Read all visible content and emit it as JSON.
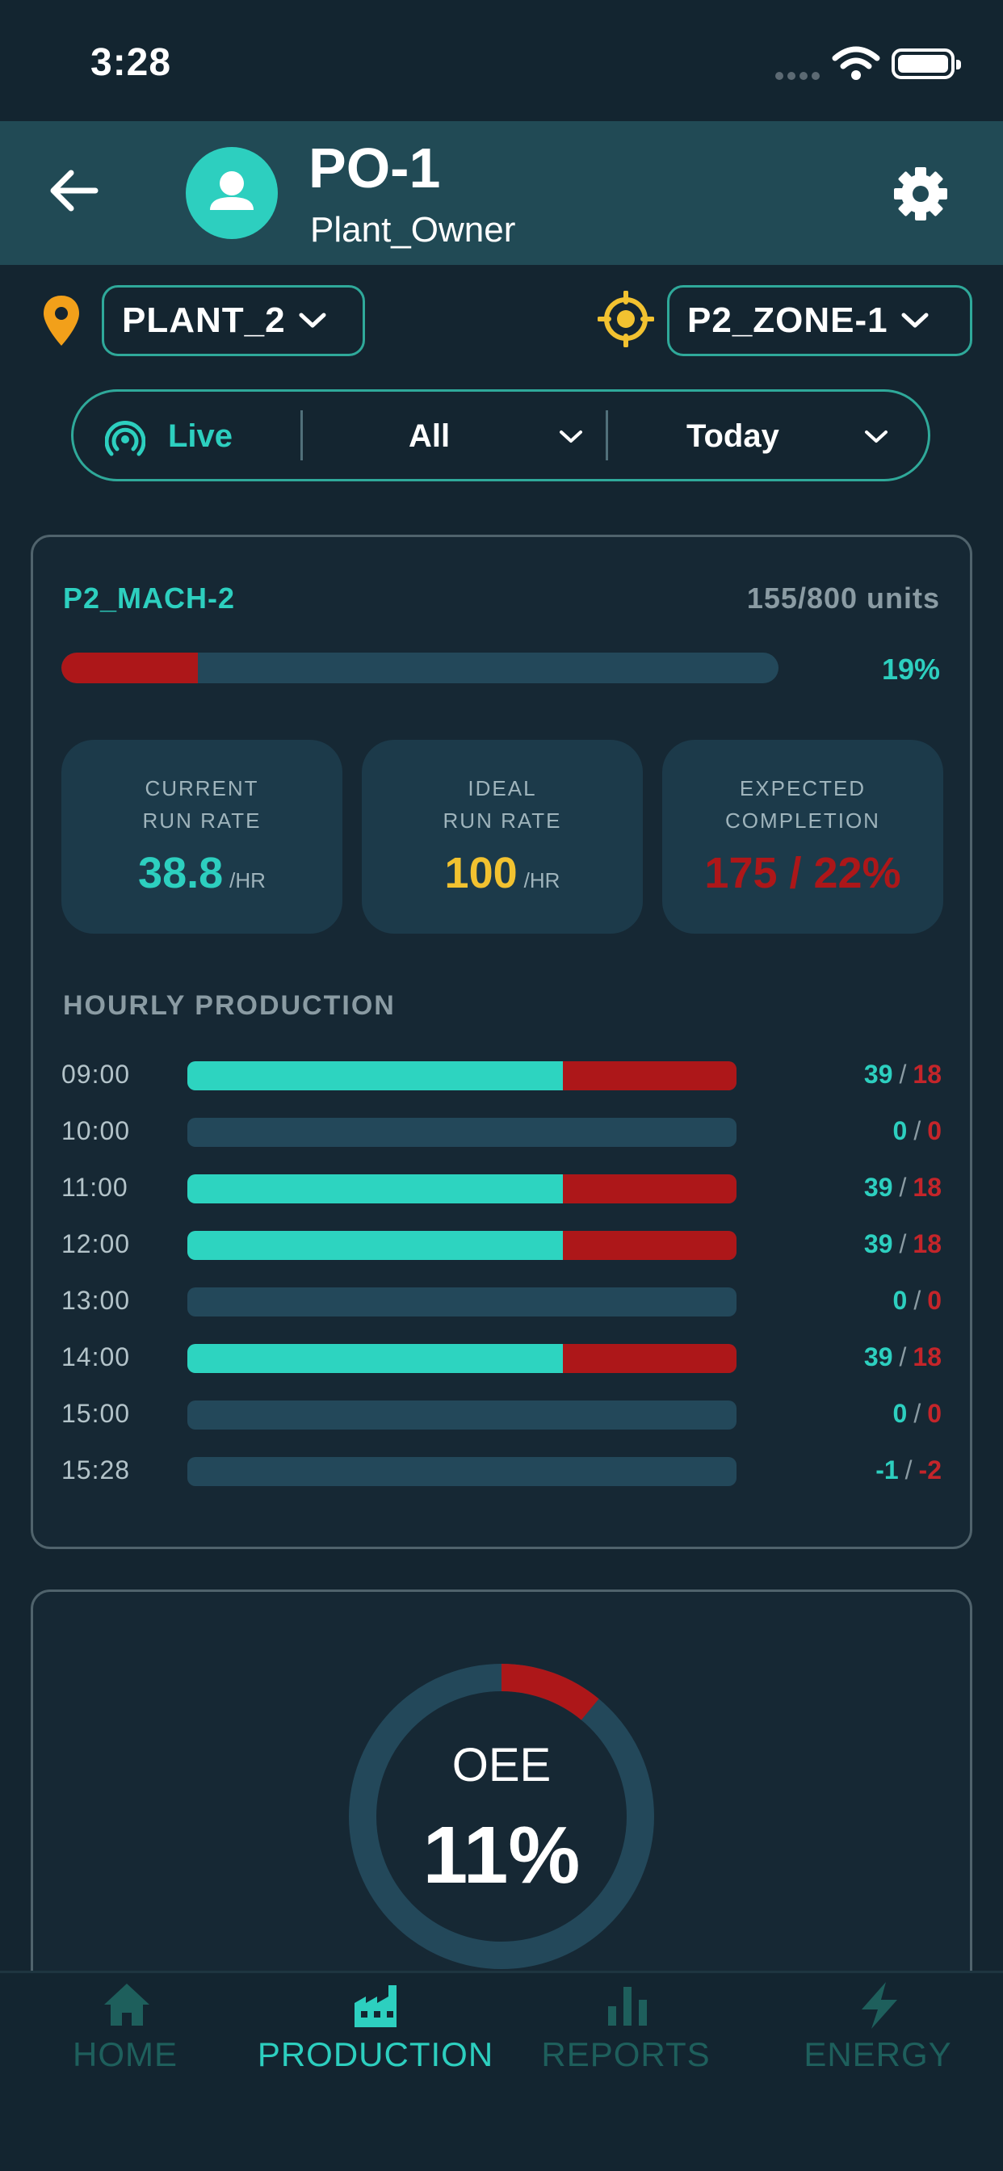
{
  "status_bar": {
    "time": "3:28"
  },
  "header": {
    "title": "PO-1",
    "subtitle": "Plant_Owner"
  },
  "selectors": {
    "plant": "PLANT_2",
    "zone": "P2_ZONE-1"
  },
  "filter": {
    "live_label": "Live",
    "scope": "All",
    "period": "Today"
  },
  "machine": {
    "name": "P2_MACH-2",
    "units": "155/800 units",
    "progress_percent": 19,
    "progress_label": "19%",
    "tiles": [
      {
        "label_line1": "CURRENT",
        "label_line2": "RUN RATE",
        "value": "38.8",
        "unit": "/HR",
        "color": "#2dcfbf"
      },
      {
        "label_line1": "IDEAL",
        "label_line2": "RUN RATE",
        "value": "100",
        "unit": "/HR",
        "color": "#f2c230"
      },
      {
        "label_line1": "EXPECTED",
        "label_line2": "COMPLETION",
        "value": "175 / 22%",
        "unit": "",
        "color": "#ad1719"
      }
    ]
  },
  "hourly": {
    "title": "HOURLY PRODUCTION",
    "rows": [
      {
        "time": "09:00",
        "good": "39",
        "bad": "18"
      },
      {
        "time": "10:00",
        "good": "0",
        "bad": "0"
      },
      {
        "time": "11:00",
        "good": "39",
        "bad": "18"
      },
      {
        "time": "12:00",
        "good": "39",
        "bad": "18"
      },
      {
        "time": "13:00",
        "good": "0",
        "bad": "0"
      },
      {
        "time": "14:00",
        "good": "39",
        "bad": "18"
      },
      {
        "time": "15:00",
        "good": "0",
        "bad": "0"
      },
      {
        "time": "15:28",
        "good": "-1",
        "bad": "-2"
      }
    ]
  },
  "oee": {
    "label": "OEE",
    "value": "11%",
    "percent": 11
  },
  "nav": [
    {
      "label": "HOME",
      "icon": "home-icon",
      "active": false
    },
    {
      "label": "PRODUCTION",
      "icon": "factory-icon",
      "active": true
    },
    {
      "label": "REPORTS",
      "icon": "bar-chart-icon",
      "active": false
    },
    {
      "label": "ENERGY",
      "icon": "lightning-icon",
      "active": false
    }
  ],
  "colors": {
    "accent": "#2dcfbf",
    "danger": "#ad1719",
    "warning": "#f2c230",
    "inactive_nav": "#1e5f5c"
  }
}
